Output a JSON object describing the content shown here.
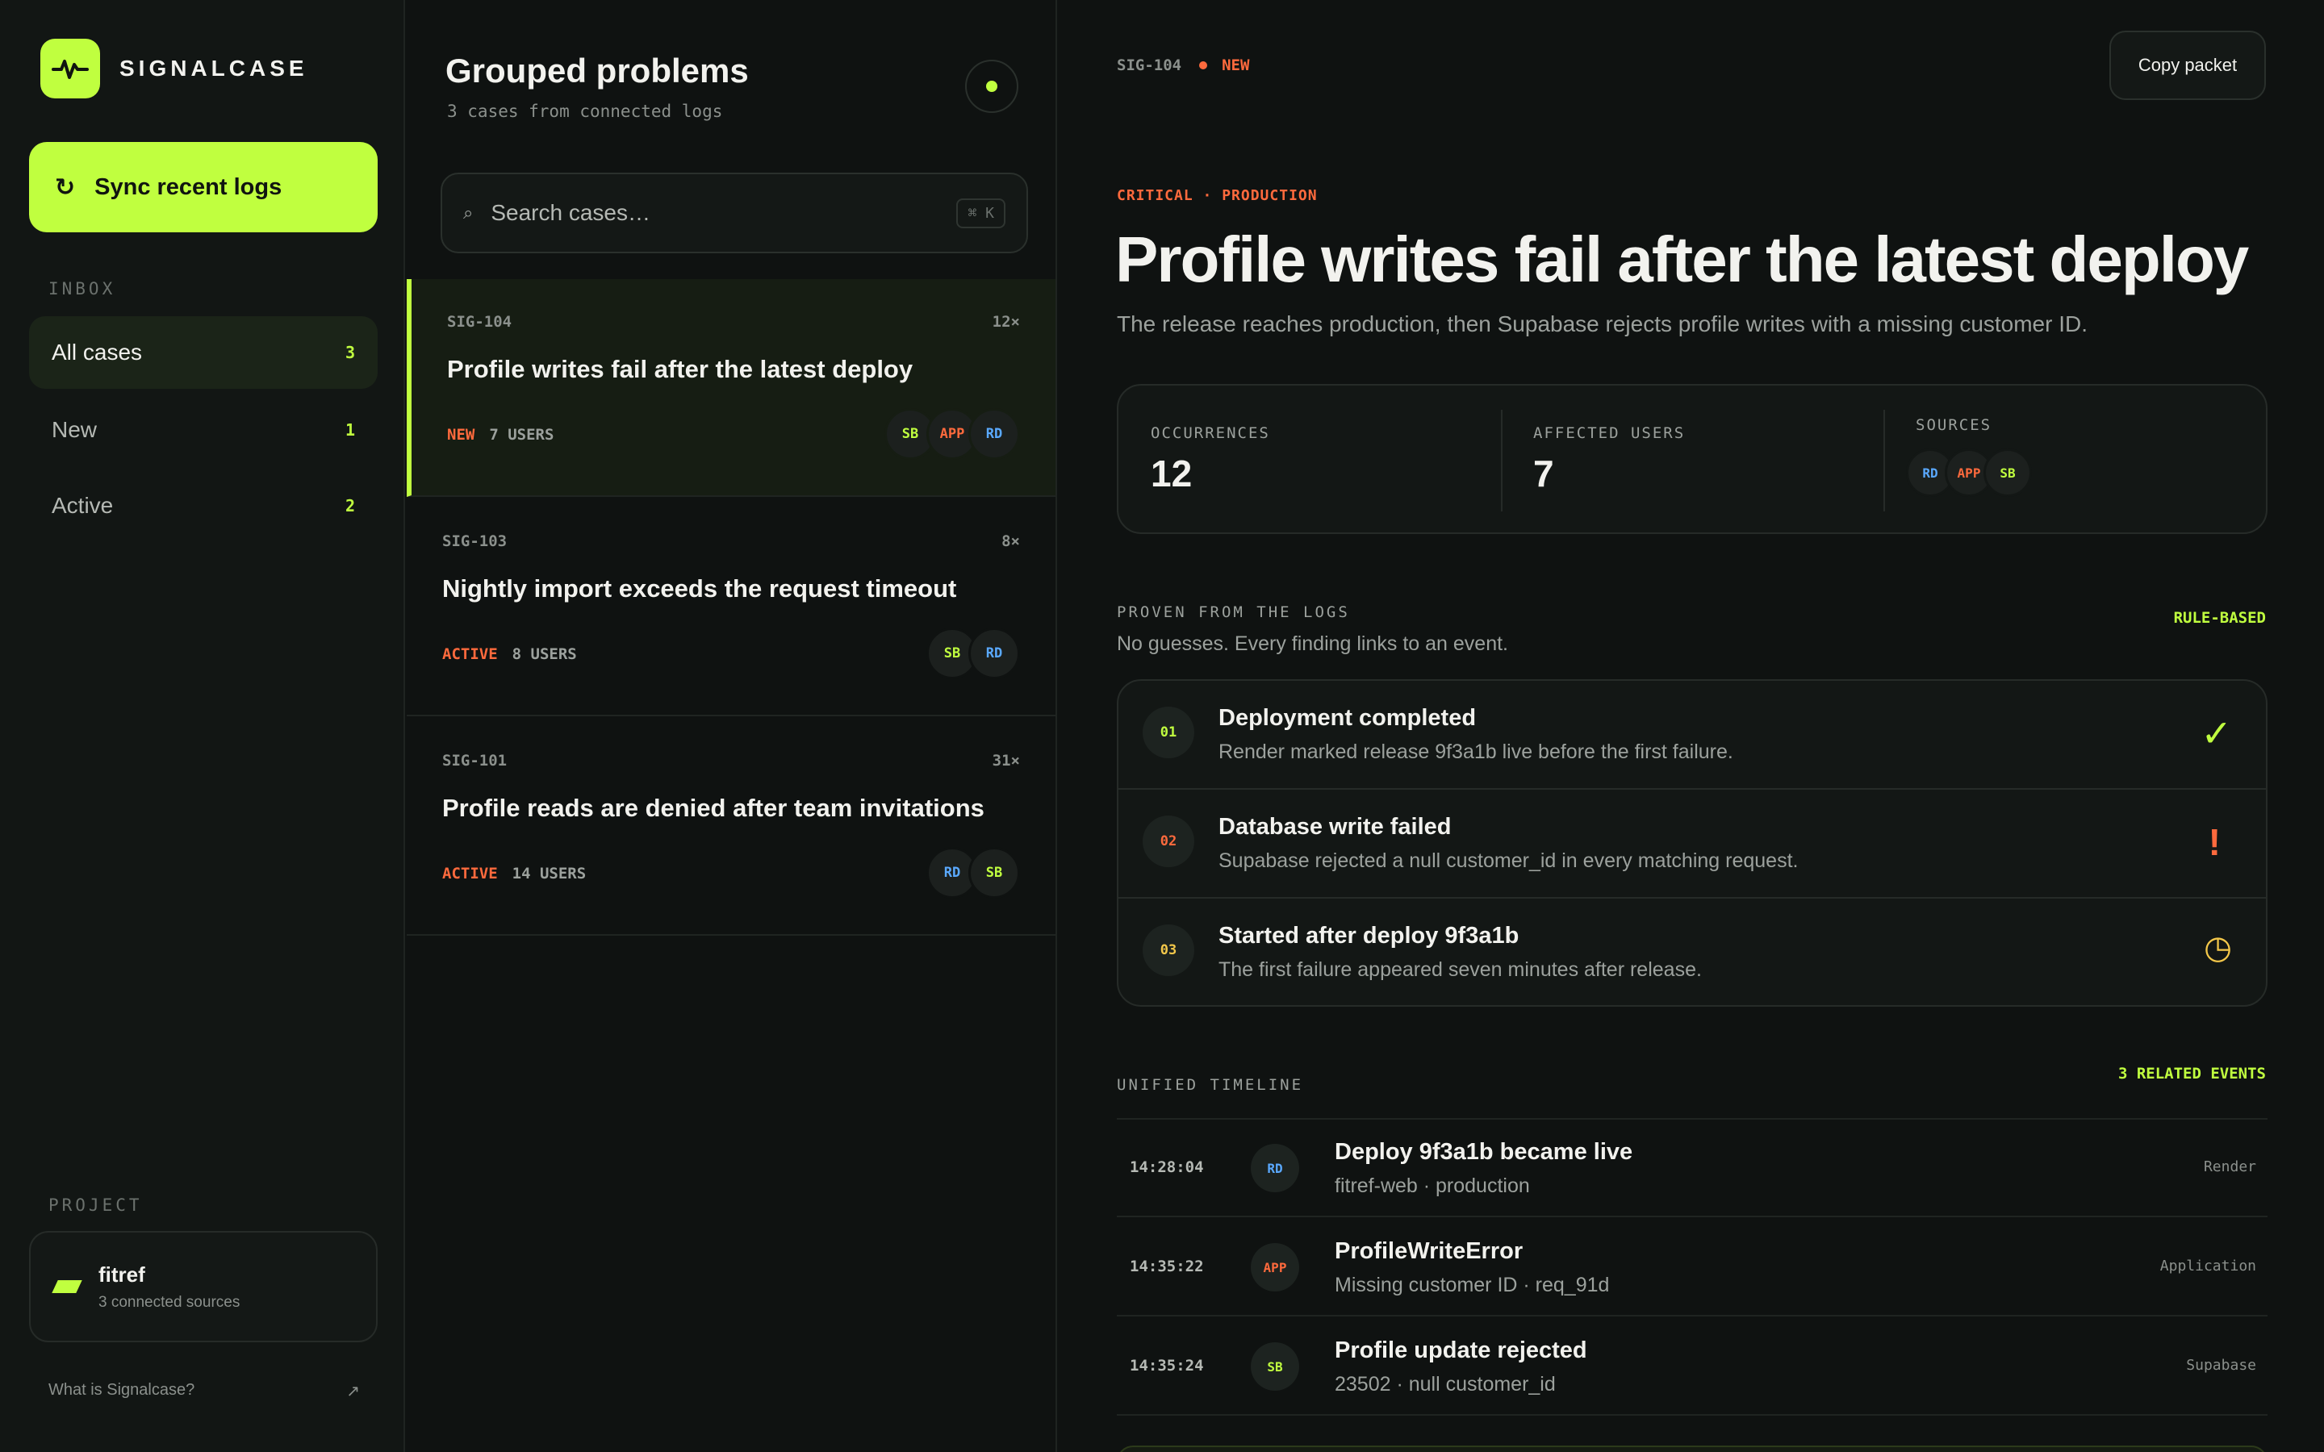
{
  "brand": {
    "name": "SIGNALCASE"
  },
  "sidebar": {
    "sync_label": "Sync recent logs",
    "inbox_label": "INBOX",
    "nav": [
      {
        "label": "All cases",
        "count": "3"
      },
      {
        "label": "New",
        "count": "1"
      },
      {
        "label": "Active",
        "count": "2"
      }
    ],
    "project_label": "PROJECT",
    "project": {
      "name": "fitref",
      "sub": "3 connected sources"
    },
    "help_link": "What is Signalcase?",
    "help_arrow": "↗"
  },
  "list": {
    "title": "Grouped problems",
    "subtitle": "3 cases from connected logs",
    "search_placeholder": "Search cases…",
    "search_shortcut": "⌘ K",
    "cases": [
      {
        "id": "SIG-104",
        "count": "12×",
        "title": "Profile writes fail after the latest deploy",
        "status": "NEW",
        "users": "7 USERS",
        "sources": [
          "SB",
          "APP",
          "RD"
        ]
      },
      {
        "id": "SIG-103",
        "count": "8×",
        "title": "Nightly import exceeds the request timeout",
        "status": "ACTIVE",
        "users": "8 USERS",
        "sources": [
          "SB",
          "RD"
        ]
      },
      {
        "id": "SIG-101",
        "count": "31×",
        "title": "Profile reads are denied after team invitations",
        "status": "ACTIVE",
        "users": "14 USERS",
        "sources": [
          "RD",
          "SB"
        ]
      }
    ]
  },
  "detail": {
    "id": "SIG-104",
    "status": "NEW",
    "copy_label": "Copy packet",
    "eyebrow": "CRITICAL · PRODUCTION",
    "title": "Profile writes fail after the latest deploy",
    "description": "The release reaches production, then Supabase rejects profile writes with a missing customer ID.",
    "stats": {
      "occurrences_label": "OCCURRENCES",
      "occurrences": "12",
      "users_label": "AFFECTED USERS",
      "users": "7",
      "sources_label": "SOURCES",
      "sources": [
        "RD",
        "APP",
        "SB"
      ]
    },
    "proven_label": "PROVEN FROM THE LOGS",
    "proven_badge": "RULE-BASED",
    "proven_sub": "No guesses. Every finding links to an event.",
    "findings": [
      {
        "num": "01",
        "title": "Deployment completed",
        "desc": "Render marked release 9f3a1b live before the first failure.",
        "icon": "✓",
        "icon_name": "check-icon",
        "color": "#c0ff3f"
      },
      {
        "num": "02",
        "title": "Database write failed",
        "desc": "Supabase rejected a null customer_id in every matching request.",
        "icon": "!",
        "icon_name": "alert-icon",
        "color": "#ff6a3d"
      },
      {
        "num": "03",
        "title": "Started after deploy 9f3a1b",
        "desc": "The first failure appeared seven minutes after release.",
        "icon": "◷",
        "icon_name": "clock-icon",
        "color": "#f4c84a"
      }
    ],
    "timeline_label": "UNIFIED TIMELINE",
    "timeline_badge": "3 RELATED EVENTS",
    "timeline": [
      {
        "time": "14:28:04",
        "src_short": "RD",
        "title": "Deploy 9f3a1b became live",
        "sub": "fitref-web · production",
        "source": "Render"
      },
      {
        "time": "14:35:22",
        "src_short": "APP",
        "title": "ProfileWriteError",
        "sub": "Missing customer ID · req_91d",
        "source": "Application"
      },
      {
        "time": "14:35:24",
        "src_short": "SB",
        "title": "Profile update rejected",
        "sub": "23502 · null customer_id",
        "source": "Supabase"
      }
    ]
  },
  "colors": {
    "accent": "#c0ff3f",
    "danger": "#ff6a3d",
    "info": "#5aa9ff",
    "warn": "#f4c84a"
  }
}
